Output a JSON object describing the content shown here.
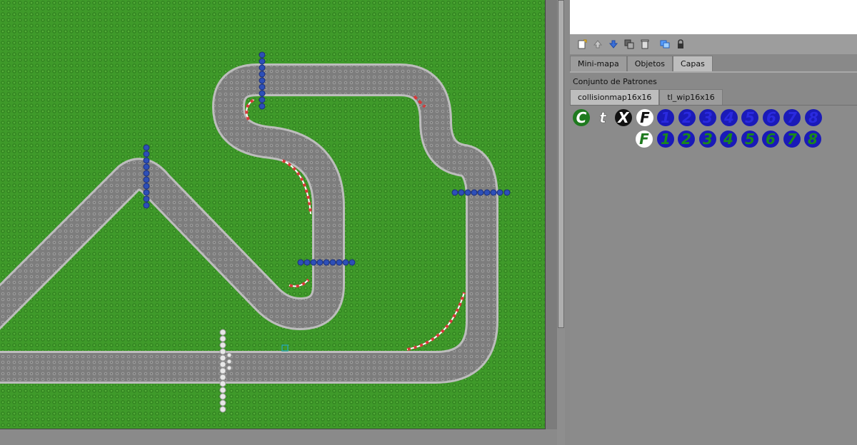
{
  "panel": {
    "layer_tabs": [
      {
        "label": "Mini-mapa",
        "active": false
      },
      {
        "label": "Objetos",
        "active": false
      },
      {
        "label": "Capas",
        "active": true
      }
    ],
    "tileset_title": "Conjunto de Patrones",
    "tileset_tabs": [
      {
        "label": "collisionmap16x16",
        "active": true
      },
      {
        "label": "tl_wip16x16",
        "active": false
      }
    ],
    "toolbar_icons": [
      "new-layer-icon",
      "move-up-icon",
      "move-down-icon",
      "duplicate-layer-icon",
      "delete-layer-icon",
      "show-layers-icon",
      "lock-icon"
    ]
  },
  "tiles": {
    "row1": [
      {
        "glyph": "C",
        "fg": "#ffffff",
        "bg": "#1f7a1f",
        "icon": "tile-c-green"
      },
      {
        "glyph": "t",
        "fg": "#ffffff",
        "bg": "transparent",
        "icon": "tile-t-plain"
      },
      {
        "glyph": "X",
        "fg": "#ffffff",
        "bg": "#111111",
        "icon": "tile-x-black"
      },
      {
        "glyph": "F",
        "fg": "#111111",
        "bg": "#ffffff",
        "icon": "tile-f-white"
      },
      {
        "glyph": "1",
        "fg": "#2a2ae0",
        "bg": "#1a1ab8",
        "icon": "tile-1-blue"
      },
      {
        "glyph": "2",
        "fg": "#2a2ae0",
        "bg": "#1a1ab8",
        "icon": "tile-2-blue"
      },
      {
        "glyph": "3",
        "fg": "#2a2ae0",
        "bg": "#1a1ab8",
        "icon": "tile-3-blue"
      },
      {
        "glyph": "4",
        "fg": "#2a2ae0",
        "bg": "#1a1ab8",
        "icon": "tile-4-blue"
      },
      {
        "glyph": "5",
        "fg": "#2a2ae0",
        "bg": "#1a1ab8",
        "icon": "tile-5-blue"
      },
      {
        "glyph": "6",
        "fg": "#2a2ae0",
        "bg": "#1a1ab8",
        "icon": "tile-6-blue"
      },
      {
        "glyph": "7",
        "fg": "#2a2ae0",
        "bg": "#1a1ab8",
        "icon": "tile-7-blue"
      },
      {
        "glyph": "8",
        "fg": "#2a2ae0",
        "bg": "#1a1ab8",
        "icon": "tile-8-blue"
      }
    ],
    "row2": [
      {
        "glyph": "F",
        "fg": "#1f7a1f",
        "bg": "#ffffff",
        "icon": "tile-f-green"
      },
      {
        "glyph": "1",
        "fg": "#1a8a1a",
        "bg": "#1a1ab8",
        "icon": "tile-1-green"
      },
      {
        "glyph": "2",
        "fg": "#1a8a1a",
        "bg": "#1a1ab8",
        "icon": "tile-2-green"
      },
      {
        "glyph": "3",
        "fg": "#1a8a1a",
        "bg": "#1a1ab8",
        "icon": "tile-3-green"
      },
      {
        "glyph": "4",
        "fg": "#1a8a1a",
        "bg": "#1a1ab8",
        "icon": "tile-4-green"
      },
      {
        "glyph": "5",
        "fg": "#1a8a1a",
        "bg": "#1a1ab8",
        "icon": "tile-5-green"
      },
      {
        "glyph": "6",
        "fg": "#1a8a1a",
        "bg": "#1a1ab8",
        "icon": "tile-6-green"
      },
      {
        "glyph": "7",
        "fg": "#1a8a1a",
        "bg": "#1a1ab8",
        "icon": "tile-7-green"
      },
      {
        "glyph": "8",
        "fg": "#1a8a1a",
        "bg": "#1a1ab8",
        "icon": "tile-8-green"
      }
    ]
  },
  "map": {
    "grass_color": "#3f9a2a",
    "road_color": "#7e7e7e",
    "road_edge_color": "#b9b9b9",
    "kerb_color": "#d63a3a",
    "checkpoint_color": "#2d4fb8",
    "finish_color": "#e8e8e8"
  }
}
